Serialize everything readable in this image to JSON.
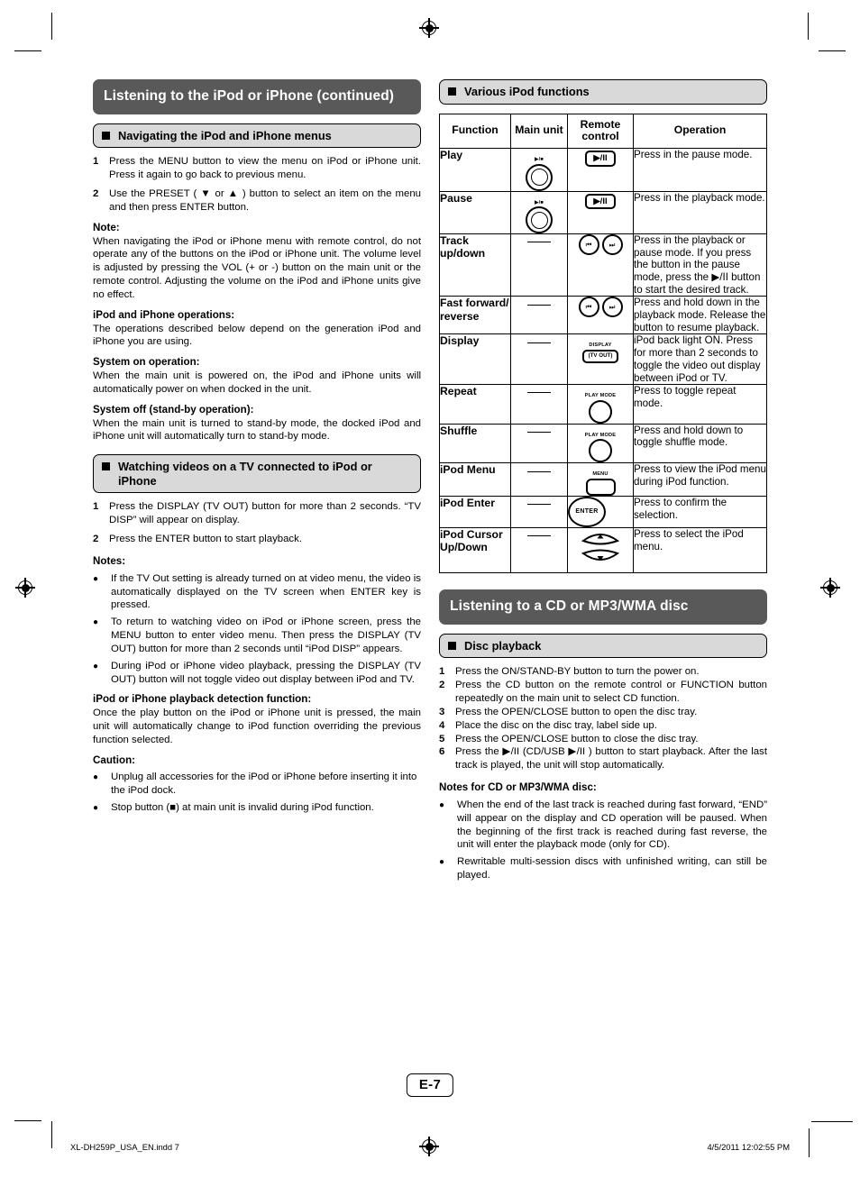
{
  "page": {
    "number": "E-7",
    "footer_left": "XL-DH259P_USA_EN.indd   7",
    "footer_right": "4/5/2011   12:02:55 PM"
  },
  "left": {
    "title": "Listening to the iPod or iPhone (continued)",
    "section1": {
      "heading": "Navigating the iPod and iPhone menus",
      "steps": [
        {
          "n": "1",
          "text": "Press the MENU button to view the menu on iPod or iPhone unit. Press it again to go back to previous menu."
        },
        {
          "n": "2",
          "text": "Use the PRESET ( ▼ or ▲ ) button to select an item on the menu and then press ENTER button."
        }
      ],
      "note_label": "Note:",
      "note_text": "When navigating the iPod or iPhone menu with remote control, do not operate any of the buttons on the iPod or iPhone unit. The volume level is adjusted by pressing the VOL (+ or -) button on the main unit or the remote control. Adjusting the volume on the iPod and iPhone units give no effect.",
      "ops_label": "iPod and iPhone operations:",
      "ops_text": "The operations described below depend on the generation iPod and iPhone you are using.",
      "on_label": "System on operation:",
      "on_text": "When the main unit is powered on, the iPod and iPhone units will automatically power on when docked in the unit.",
      "off_label": "System off (stand-by operation):",
      "off_text": "When the main unit is turned to stand-by mode, the docked iPod and iPhone unit will automatically turn to stand-by mode."
    },
    "section2": {
      "heading": "Watching videos on a TV connected to iPod or iPhone",
      "steps": [
        {
          "n": "1",
          "text": "Press the DISPLAY (TV OUT) button for more than 2 seconds. “TV DISP” will appear on display."
        },
        {
          "n": "2",
          "text": "Press the ENTER button to start playback."
        }
      ],
      "notes_label": "Notes:",
      "notes": [
        "If the TV Out setting is already turned on at video menu, the video is automatically displayed on the TV screen when ENTER key is pressed.",
        "To return to watching video on iPod or iPhone screen, press the MENU button to enter video menu. Then press the DISPLAY (TV OUT) button for more than 2 seconds until “iPod DISP” appears.",
        "During iPod or iPhone video playback, pressing the DISPLAY (TV OUT) button will not toggle video out display between iPod and TV."
      ],
      "detect_label": "iPod or iPhone playback detection function:",
      "detect_text": "Once the play button on the iPod or iPhone unit is pressed, the main unit will automatically change to iPod function overriding the previous function selected.",
      "caution_label": "Caution:",
      "cautions": [
        "Unplug all accessories for the iPod or iPhone before inserting it into the iPod dock.",
        "Stop button (■) at main unit is invalid during iPod function."
      ]
    }
  },
  "right": {
    "section1": {
      "heading": "Various iPod functions",
      "table": {
        "headers": [
          "Function",
          "Main unit",
          "Remote control",
          "Operation"
        ],
        "rows": [
          {
            "function": "Play",
            "main_unit": {
              "icon": "double-circle-play-stop-icon",
              "label": "▶/■"
            },
            "remote": {
              "icon": "play-pause-button-icon",
              "label": "▶/II"
            },
            "operation": "Press in the pause mode."
          },
          {
            "function": "Pause",
            "main_unit": {
              "icon": "double-circle-play-stop-icon",
              "label": "▶/■"
            },
            "remote": {
              "icon": "play-pause-button-icon",
              "label": "▶/II"
            },
            "operation": "Press in the playback mode."
          },
          {
            "function": "Track up/down",
            "main_unit": {
              "icon": "dash-icon",
              "label": ""
            },
            "remote": {
              "icon": "skip-back-forward-icon",
              "label": ""
            },
            "operation": "Press in the playback or pause mode. If you press the button in the pause mode, press the ▶/II button to start the desired track."
          },
          {
            "function": "Fast forward/ reverse",
            "main_unit": {
              "icon": "dash-icon",
              "label": ""
            },
            "remote": {
              "icon": "skip-back-forward-icon",
              "label": ""
            },
            "operation": "Press and hold down in the playback mode. Release the button to resume playback."
          },
          {
            "function": "Display",
            "main_unit": {
              "icon": "dash-icon",
              "label": ""
            },
            "remote": {
              "icon": "display-tv-out-button-icon",
              "label": "DISPLAY",
              "inner": "(TV OUT)"
            },
            "operation": "iPod back light ON. Press for more than 2 seconds to toggle the video out display between iPod or TV."
          },
          {
            "function": "Repeat",
            "main_unit": {
              "icon": "dash-icon",
              "label": ""
            },
            "remote": {
              "icon": "play-mode-button-icon",
              "label": "PLAY MODE"
            },
            "operation": "Press to toggle repeat mode."
          },
          {
            "function": "Shuffle",
            "main_unit": {
              "icon": "dash-icon",
              "label": ""
            },
            "remote": {
              "icon": "play-mode-button-icon",
              "label": "PLAY MODE"
            },
            "operation": "Press and hold down to toggle shuffle mode."
          },
          {
            "function": "iPod Menu",
            "main_unit": {
              "icon": "dash-icon",
              "label": ""
            },
            "remote": {
              "icon": "menu-button-icon",
              "label": "MENU"
            },
            "operation": "Press to view the iPod menu during iPod function."
          },
          {
            "function": "iPod Enter",
            "main_unit": {
              "icon": "dash-icon",
              "label": ""
            },
            "remote": {
              "icon": "enter-button-icon",
              "label": "ENTER"
            },
            "operation": "Press to confirm the selection."
          },
          {
            "function": "iPod Cursor Up/Down",
            "main_unit": {
              "icon": "dash-icon",
              "label": ""
            },
            "remote": {
              "icon": "cursor-up-down-icon",
              "label": ""
            },
            "operation": "Press to select the iPod menu."
          }
        ]
      }
    },
    "section2": {
      "title": "Listening to a CD or MP3/WMA disc",
      "heading": "Disc playback",
      "steps": [
        {
          "n": "1",
          "text": "Press the ON/STAND-BY button to turn the power on."
        },
        {
          "n": "2",
          "text": "Press the CD button on the remote control or FUNCTION button repeatedly on the main unit to select CD function."
        },
        {
          "n": "3",
          "text": "Press the OPEN/CLOSE button to open the disc tray."
        },
        {
          "n": "4",
          "text": "Place the disc on the disc tray, label side up."
        },
        {
          "n": "5",
          "text": "Press the OPEN/CLOSE button to close the disc tray."
        },
        {
          "n": "6",
          "text": "Press the ▶/II (CD/USB ▶/II ) button to start playback. After the last track is played, the unit will stop automatically."
        }
      ],
      "notes_label": "Notes for CD or MP3/WMA disc:",
      "notes": [
        "When the end of the last track is reached during fast forward, “END” will appear on the display and CD operation will be paused. When the beginning of the first track is reached during fast reverse, the unit will enter the playback mode (only for CD).",
        "Rewritable multi-session discs with unfinished writing, can still be played."
      ]
    }
  },
  "colors": {
    "title_bar": "#595959",
    "sub_bar": "#d9d9d9",
    "text": "#000000"
  }
}
